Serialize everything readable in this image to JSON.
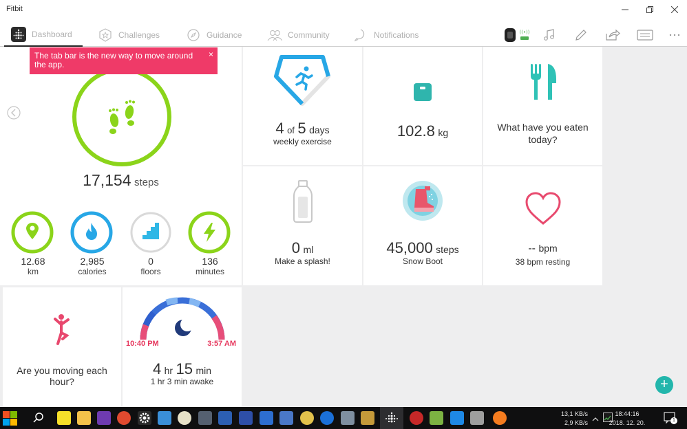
{
  "window": {
    "title": "Fitbit"
  },
  "nav": {
    "tabs": [
      {
        "label": "Dashboard",
        "icon": "dashboard-icon"
      },
      {
        "label": "Challenges",
        "icon": "challenges-icon"
      },
      {
        "label": "Guidance",
        "icon": "guidance-icon"
      },
      {
        "label": "Community",
        "icon": "community-icon"
      },
      {
        "label": "Notifications",
        "icon": "notifications-icon"
      }
    ],
    "tools": [
      "device-icon",
      "music-icon",
      "edit-icon",
      "share-icon",
      "card-icon",
      "more-icon"
    ]
  },
  "toast": {
    "text": "The tab bar is the new way to move around the app.",
    "close": "×"
  },
  "steps": {
    "value": "17,154",
    "unit": "steps"
  },
  "stats": [
    {
      "value": "12.68",
      "unit": "km",
      "color": "#8bd41a"
    },
    {
      "value": "2,985",
      "unit": "calories",
      "color": "#27a7e6"
    },
    {
      "value": "0",
      "unit": "floors",
      "color": "#2fb7e6"
    },
    {
      "value": "136",
      "unit": "minutes",
      "color": "#8bd41a"
    }
  ],
  "exercise": {
    "num": "4",
    "of": "of",
    "total": "5",
    "unit": "days",
    "label": "weekly exercise"
  },
  "weight": {
    "value": "102.8",
    "unit": "kg"
  },
  "food": {
    "text": "What have you eaten today?"
  },
  "water": {
    "value": "0",
    "unit": "ml",
    "label": "Make a splash!"
  },
  "challenge": {
    "value": "45,000",
    "unit": "steps",
    "label": "Snow Boot"
  },
  "heart": {
    "value": "--",
    "unit": "bpm",
    "label": "38 bpm resting"
  },
  "hourly": {
    "text": "Are you moving each hour?"
  },
  "sleep": {
    "start": "10:40 PM",
    "end": "3:57 AM",
    "hr": "4",
    "hr_unit": "hr",
    "min": "15",
    "min_unit": "min",
    "awake": "1 hr 3 min awake"
  },
  "fab": {
    "label": "+"
  },
  "taskbar": {
    "net_up": "13,1 KB/s",
    "net_down": "2,9 KB/s",
    "time": "18:44:16",
    "date": "2018. 12. 20.",
    "notif_count": "1"
  },
  "colors": {
    "accent_teal": "#23b6ac",
    "toast_pink": "#ef3a68",
    "heart_pink": "#e84a6e",
    "green": "#8bd41a"
  }
}
